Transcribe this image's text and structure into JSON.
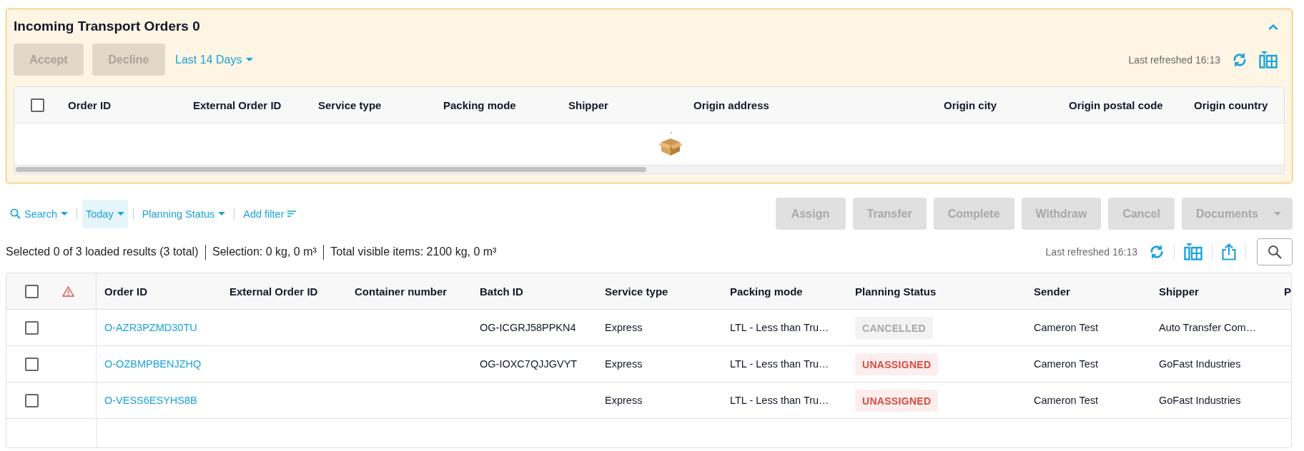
{
  "incoming_panel": {
    "title": "Incoming Transport Orders 0",
    "expanded": true,
    "buttons": [
      {
        "label": "Accept",
        "disabled": true
      },
      {
        "label": "Decline",
        "disabled": true
      }
    ],
    "period_filter": "Last 14 Days",
    "last_refreshed": "Last refreshed 16:13",
    "table": {
      "select_all_checked": false,
      "columns": [
        "Order ID",
        "External Order ID",
        "Service type",
        "Packing mode",
        "Shipper",
        "Origin address",
        "Origin city",
        "Origin postal code",
        "Origin country"
      ]
    }
  },
  "filters": [
    {
      "label": "Search",
      "kind": "search",
      "selected": false
    },
    {
      "label": "Today",
      "kind": "dropdown",
      "selected": true
    },
    {
      "label": "Planning Status",
      "kind": "dropdown",
      "selected": false
    },
    {
      "label": "Add filter",
      "kind": "add",
      "selected": false
    }
  ],
  "actions": [
    {
      "label": "Assign",
      "disabled": true
    },
    {
      "label": "Transfer",
      "disabled": true
    },
    {
      "label": "Complete",
      "disabled": true
    },
    {
      "label": "Withdraw",
      "disabled": true
    },
    {
      "label": "Cancel",
      "disabled": true
    },
    {
      "label": "Documents",
      "disabled": true,
      "kind": "dropdown"
    }
  ],
  "summary": [
    "Selected 0 of 3 loaded results (3 total)",
    "Selection: 0 kg, 0 m³",
    "Total visible items: 2100 kg, 0 m³"
  ],
  "last_refreshed": "Last refreshed 16:13",
  "table": {
    "select_all_checked": false,
    "columns": [
      "Order ID",
      "External Order ID",
      "Container number",
      "Batch ID",
      "Service type",
      "Packing mode",
      "Planning Status",
      "Sender",
      "Shipper",
      "P"
    ],
    "rows": [
      {
        "checked": false,
        "order_id": "O-AZR3PZMD30TU",
        "batch_id": "OG-ICGRJ58PPKN4",
        "service_type": "Express",
        "packing_mode": "LTL - Less than Tru…",
        "planning_status": {
          "label": "CANCELLED",
          "kind": "cancelled"
        },
        "sender": "Cameron Test",
        "shipper": "Auto Transfer Com…"
      },
      {
        "checked": false,
        "order_id": "O-OZBMPBENJZHQ",
        "batch_id": "OG-IOXC7QJJGVYT",
        "service_type": "Express",
        "packing_mode": "LTL - Less than Tru…",
        "planning_status": {
          "label": "UNASSIGNED",
          "kind": "unassigned"
        },
        "sender": "Cameron Test",
        "shipper": "GoFast Industries"
      },
      {
        "checked": false,
        "order_id": "O-VESS6ESYHS8B",
        "service_type": "Express",
        "packing_mode": "LTL - Less than Tru…",
        "planning_status": {
          "label": "UNASSIGNED",
          "kind": "unassigned"
        },
        "sender": "Cameron Test",
        "shipper": "GoFast Industries"
      }
    ]
  }
}
